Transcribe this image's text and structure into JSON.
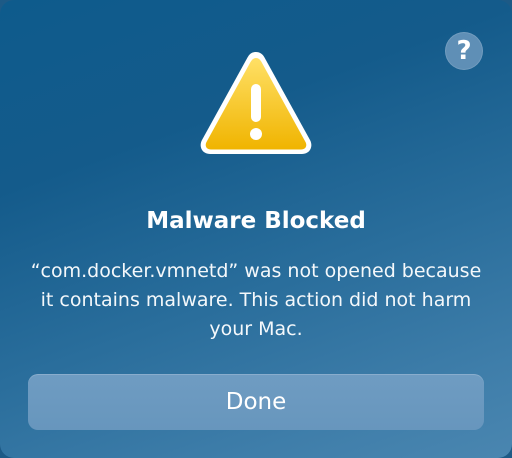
{
  "dialog": {
    "title": "Malware Blocked",
    "message": "“com.docker.vmnetd” was not opened because it contains malware. This action did not harm your Mac.",
    "help_button_label": "?",
    "done_button_label": "Done",
    "icon": "warning-triangle-icon",
    "colors": {
      "background": "#1d5f8e",
      "warning_yellow": "#f5c518",
      "button": "#6b99bf"
    }
  }
}
